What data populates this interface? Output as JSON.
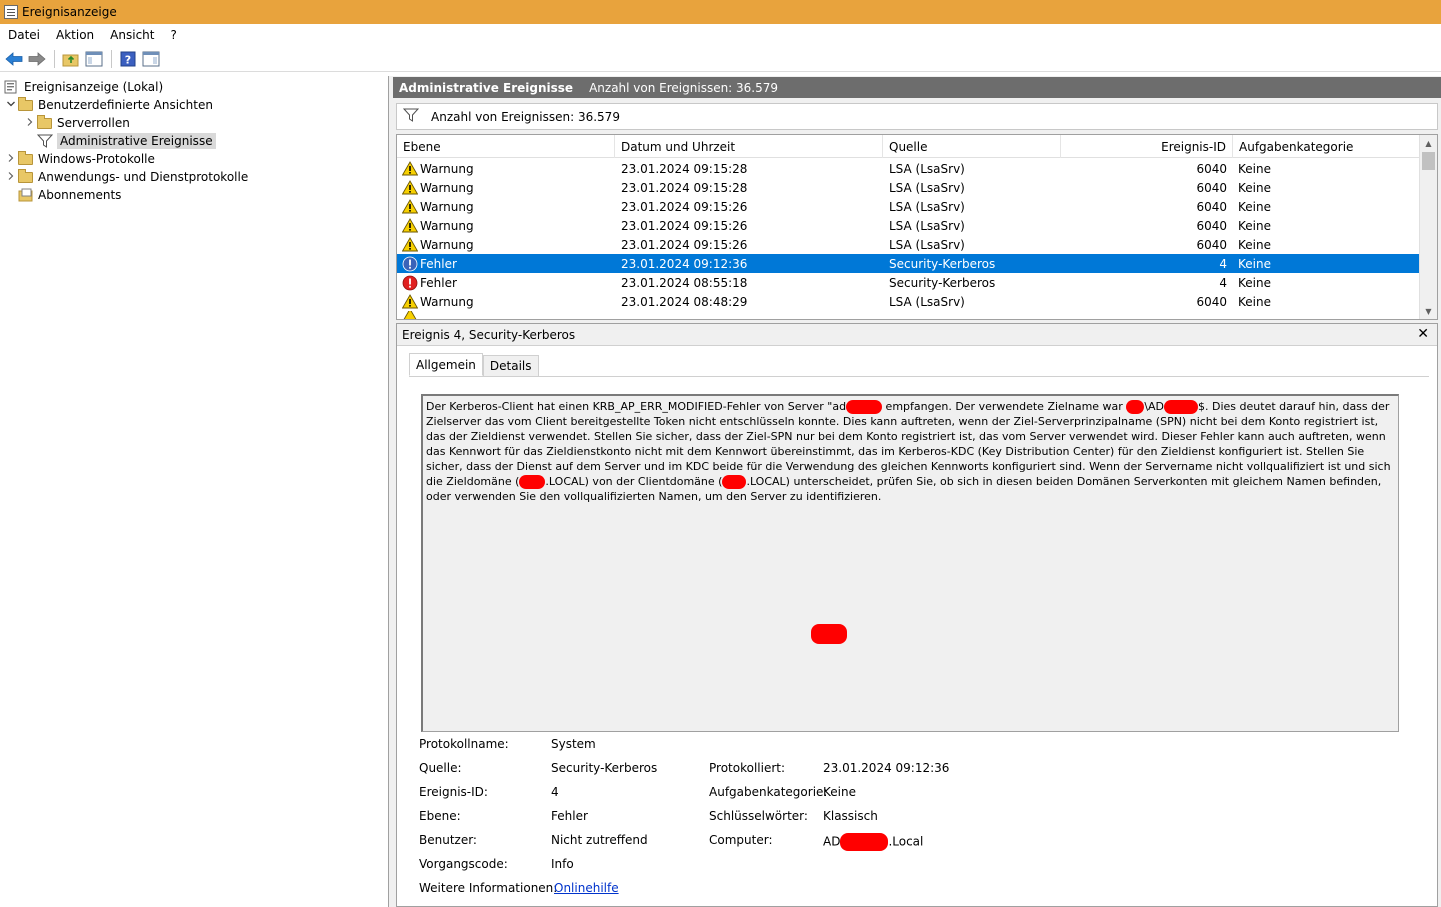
{
  "window": {
    "title": "Ereignisanzeige"
  },
  "menu": {
    "items": [
      "Datei",
      "Aktion",
      "Ansicht",
      "?"
    ]
  },
  "tree": {
    "items": [
      {
        "label": "Ereignisanzeige (Lokal)",
        "icon": "event-viewer-icon"
      },
      {
        "label": "Benutzerdefinierte Ansichten",
        "icon": "folder-icon"
      },
      {
        "label": "Serverrollen",
        "icon": "folder-icon"
      },
      {
        "label": "Administrative Ereignisse",
        "icon": "filter-icon"
      },
      {
        "label": "Windows-Protokolle",
        "icon": "folder-icon"
      },
      {
        "label": "Anwendungs- und Dienstprotokolle",
        "icon": "folder-icon"
      },
      {
        "label": "Abonnements",
        "icon": "subscriptions-icon"
      }
    ]
  },
  "header": {
    "title": "Administrative Ereignisse",
    "count": "Anzahl von Ereignissen: 36.579"
  },
  "filter": {
    "text": "Anzahl von Ereignissen: 36.579"
  },
  "grid": {
    "columns": [
      "Ebene",
      "Datum und Uhrzeit",
      "Quelle",
      "Ereignis-ID",
      "Aufgabenkategorie"
    ],
    "rows": [
      {
        "level": "Warnung",
        "date": "23.01.2024 09:15:28",
        "source": "LSA (LsaSrv)",
        "id": "6040",
        "category": "Keine"
      },
      {
        "level": "Warnung",
        "date": "23.01.2024 09:15:28",
        "source": "LSA (LsaSrv)",
        "id": "6040",
        "category": "Keine"
      },
      {
        "level": "Warnung",
        "date": "23.01.2024 09:15:26",
        "source": "LSA (LsaSrv)",
        "id": "6040",
        "category": "Keine"
      },
      {
        "level": "Warnung",
        "date": "23.01.2024 09:15:26",
        "source": "LSA (LsaSrv)",
        "id": "6040",
        "category": "Keine"
      },
      {
        "level": "Warnung",
        "date": "23.01.2024 09:15:26",
        "source": "LSA (LsaSrv)",
        "id": "6040",
        "category": "Keine"
      },
      {
        "level": "Fehler",
        "date": "23.01.2024 09:12:36",
        "source": "Security-Kerberos",
        "id": "4",
        "category": "Keine"
      },
      {
        "level": "Fehler",
        "date": "23.01.2024 08:55:18",
        "source": "Security-Kerberos",
        "id": "4",
        "category": "Keine"
      },
      {
        "level": "Warnung",
        "date": "23.01.2024 08:48:29",
        "source": "LSA (LsaSrv)",
        "id": "6040",
        "category": "Keine"
      }
    ]
  },
  "detail": {
    "title": "Ereignis 4, Security-Kerberos",
    "tabs": [
      "Allgemein",
      "Details"
    ],
    "desc": {
      "p1": "Der Kerberos-Client hat einen KRB_AP_ERR_MODIFIED-Fehler von Server \"ad",
      "p2": " empfangen. Der verwendete Zielname war ",
      "p3": "\\AD",
      "p4": "$. Dies deutet darauf hin, dass der Zielserver das vom Client bereitgestellte Token nicht entschlüsseln konnte. Dies kann auftreten, wenn der Ziel-Serverprinzipalname (SPN) nicht bei dem Konto registriert ist, das der Zieldienst verwendet. Stellen Sie sicher, dass der Ziel-SPN nur bei dem Konto registriert ist, das vom Server verwendet wird. Dieser Fehler kann auch auftreten, wenn das Kennwort für das Zieldienstkonto nicht mit dem Kennwort übereinstimmt, das im Kerberos-KDC (Key Distribution Center) für den Zieldienst konfiguriert ist. Stellen Sie sicher, dass der Dienst auf dem Server und im KDC beide für die Verwendung des gleichen Kennworts konfiguriert sind. Wenn der Servername nicht vollqualifiziert ist und sich die Zieldomäne (",
      "p5": ".LOCAL) von der Clientdomäne (",
      "p6": ".LOCAL) unterscheidet, prüfen Sie, ob sich in diesen beiden Domänen Serverkonten mit gleichem Namen befinden, oder verwenden Sie den vollqualifizierten Namen, um den Server zu identifizieren."
    },
    "props": {
      "log_label": "Protokollname:",
      "log_value": "System",
      "source_label": "Quelle:",
      "source_value": "Security-Kerberos",
      "logged_label": "Protokolliert:",
      "logged_value": "23.01.2024 09:12:36",
      "id_label": "Ereignis-ID:",
      "id_value": "4",
      "task_label": "Aufgabenkategorie:",
      "task_value": "Keine",
      "level_label": "Ebene:",
      "level_value": "Fehler",
      "keywords_label": "Schlüsselwörter:",
      "keywords_value": "Klassisch",
      "user_label": "Benutzer:",
      "user_value": "Nicht zutreffend",
      "computer_label": "Computer:",
      "computer_prefix": "AD",
      "computer_suffix": ".Local",
      "opcode_label": "Vorgangscode:",
      "opcode_value": "Info",
      "more_label": "Weitere Informationen:",
      "more_link": "Onlinehilfe"
    }
  },
  "colors": {
    "titlebar": "#e8a33d",
    "selection": "#0078d7",
    "header": "#6d6d6d",
    "redaction": "#ff0000"
  }
}
